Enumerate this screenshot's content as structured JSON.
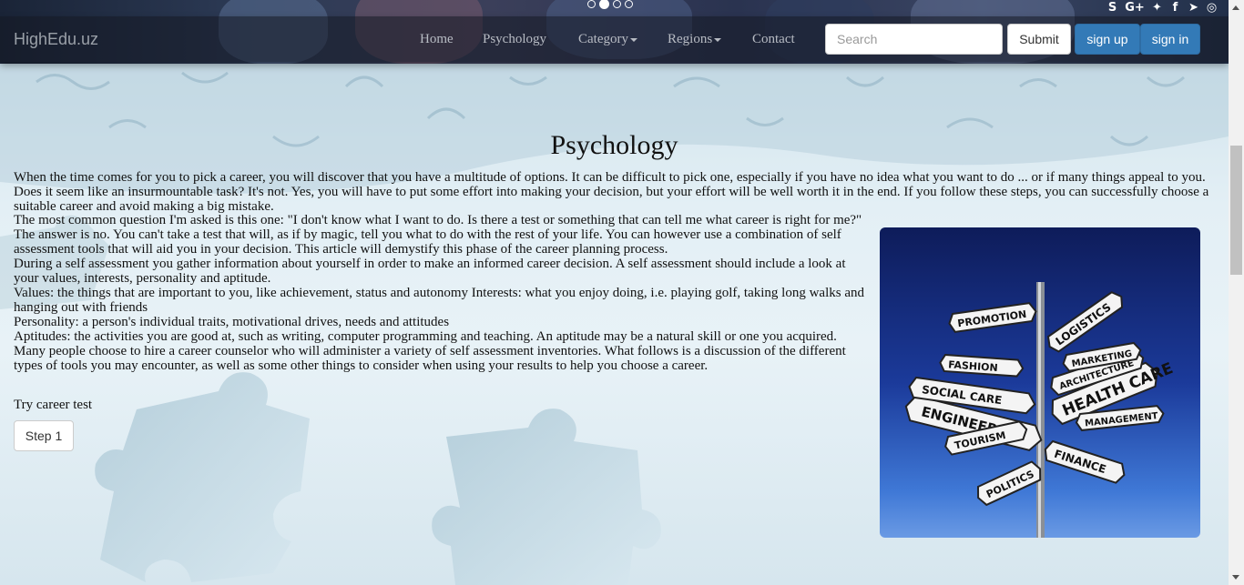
{
  "brand": "HighEdu.uz",
  "nav": {
    "home": "Home",
    "psychology": "Psychology",
    "category": "Category",
    "regions": "Regions",
    "contact": "Contact"
  },
  "search": {
    "placeholder": "Search",
    "submit": "Submit"
  },
  "auth": {
    "signup": "sign up",
    "signin": "sign in"
  },
  "social_icons": [
    "skype-icon",
    "google-plus-icon",
    "twitter-icon",
    "facebook-icon",
    "telegram-icon",
    "instagram-icon"
  ],
  "carousel": {
    "slides": 4,
    "active": 2
  },
  "page": {
    "title": "Psychology",
    "intro": "When the time comes for you to pick a career, you will discover that you have a multitude of options. It can be difficult to pick one, especially if you have no idea what you want to do ... or if many things appeal to you. Does it seem like an insurmountable task? It's not. Yes, you will have to put some effort into making your decision, but your effort will be well worth it in the end. If you follow these steps, you can successfully choose a suitable career and avoid making a big mistake.",
    "paragraphs": [
      "The most common question I'm asked is this one: \"I don't know what I want to do. Is there a test or something that can tell me what career is right for me?\" The answer is no. You can't take a test that will, as if by magic, tell you what to do with the rest of your life. You can however use a combination of self assessment tools that will aid you in your decision. This article will demystify this phase of the career planning process.",
      "During a self assessment you gather information about yourself in order to make an informed career decision. A self assessment should include a look at your values, interests, personality and aptitude.",
      "Values: the things that are important to you, like achievement, status and autonomy Interests: what you enjoy doing, i.e. playing golf, taking long walks and hanging out with friends",
      "Personality: a person's individual traits, motivational drives, needs and attitudes",
      "Aptitudes: the activities you are good at, such as writing, computer programming and teaching. An aptitude may be a natural skill or one you acquired.",
      "Many people choose to hire a career counselor who will administer a variety of self assessment inventories. What follows is a discussion of the different types of tools you may encounter, as well as some other things to consider when using your results to help you choose a career."
    ],
    "try_label": "Try career test",
    "step_button": "Step 1"
  },
  "signpost": {
    "labels": [
      "ENGINEERING",
      "SOCIAL CARE",
      "HEALTH CARE",
      "FINANCE",
      "POLITICS",
      "TOURISM",
      "FASHION",
      "ARCHITECTURE",
      "LOGISTICS",
      "PROMOTION",
      "MANAGEMENT",
      "MARKETING"
    ]
  },
  "colors": {
    "primary": "#337ab7",
    "navbar": "#141822",
    "image_bg_top": "#0e1c5a",
    "image_bg_bottom": "#6a9ae4"
  }
}
